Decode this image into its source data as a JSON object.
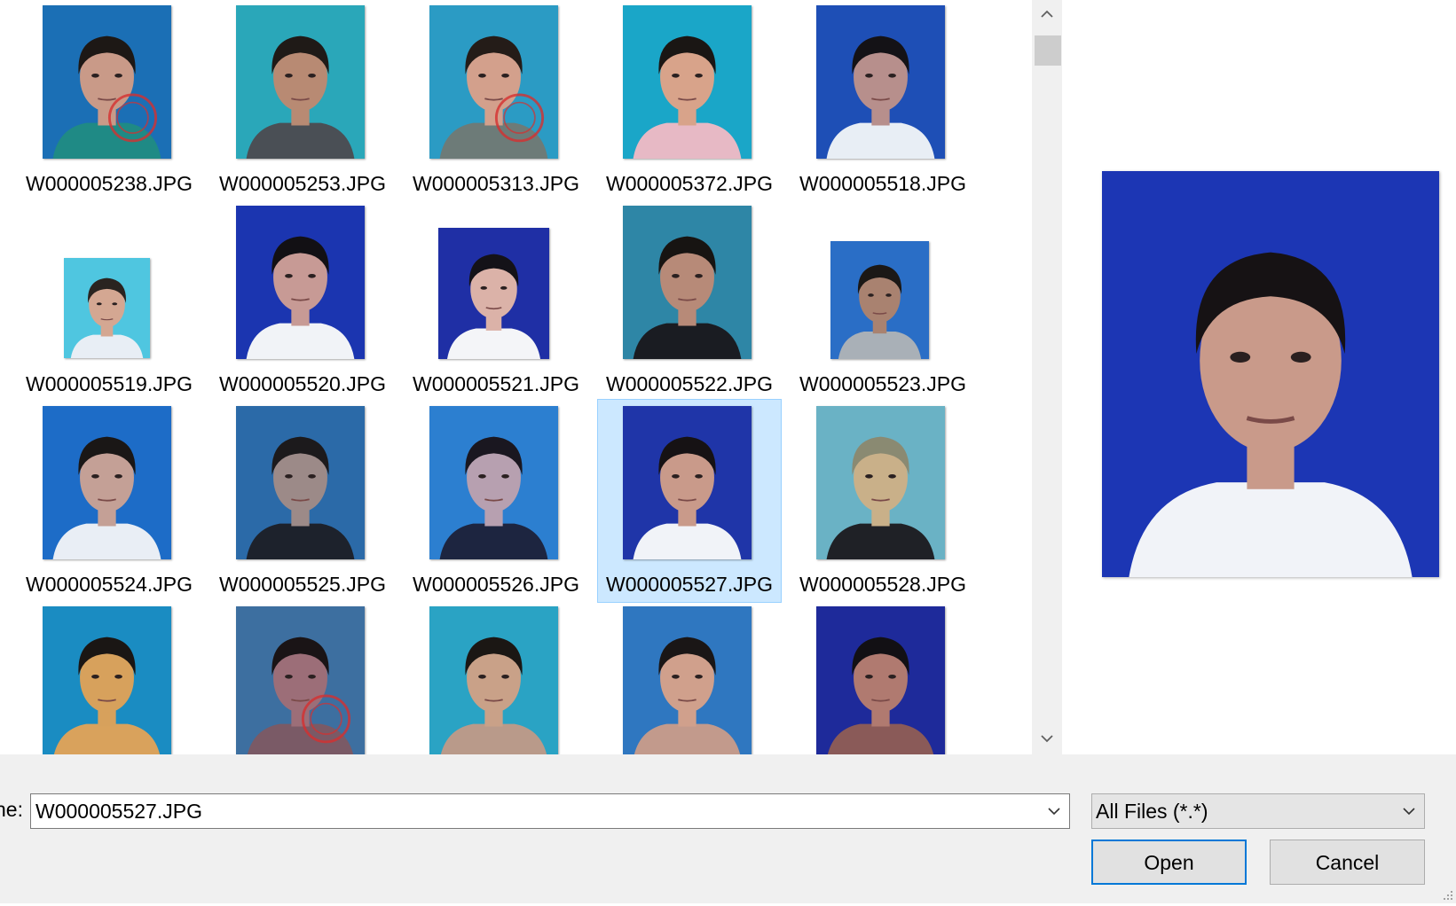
{
  "files": [
    {
      "name": "W000005238.JPG",
      "bg": "#1b6fb5",
      "skin": "#c99a88",
      "hair": "#1d1815",
      "shirt": "#1f8a85",
      "stamp": true
    },
    {
      "name": "W000005253.JPG",
      "bg": "#2aa7b9",
      "skin": "#b88a73",
      "hair": "#1f1a17",
      "shirt": "#4a4f55",
      "stamp": false
    },
    {
      "name": "W000005313.JPG",
      "bg": "#2b9bc4",
      "skin": "#d3a08c",
      "hair": "#241c18",
      "shirt": "#6d7b78",
      "stamp": true
    },
    {
      "name": "W000005372.JPG",
      "bg": "#1aa6c8",
      "skin": "#d8a38a",
      "hair": "#1a1614",
      "shirt": "#e7b9c5",
      "stamp": false
    },
    {
      "name": "W000005518.JPG",
      "bg": "#1e4fb6",
      "skin": "#b78f8c",
      "hair": "#141216",
      "shirt": "#e8eef5",
      "stamp": false
    },
    {
      "name": "W000005519.JPG",
      "bg": "#4fc6e0",
      "skin": "#d4a792",
      "hair": "#2a2420",
      "shirt": "#e8eef5",
      "stamp": false
    },
    {
      "name": "W000005520.JPG",
      "bg": "#1b35b0",
      "skin": "#c79a95",
      "hair": "#121014",
      "shirt": "#f1f3f7",
      "stamp": false
    },
    {
      "name": "W000005521.JPG",
      "bg": "#1f2fa5",
      "skin": "#dbb2a8",
      "hair": "#141218",
      "shirt": "#f4f5f8",
      "stamp": false
    },
    {
      "name": "W000005522.JPG",
      "bg": "#2e86a6",
      "skin": "#b78a78",
      "hair": "#171412",
      "shirt": "#1a1c22",
      "stamp": false
    },
    {
      "name": "W000005523.JPG",
      "bg": "#2a6ec6",
      "skin": "#a98270",
      "hair": "#1b1816",
      "shirt": "#a9b0b7",
      "stamp": false
    },
    {
      "name": "W000005524.JPG",
      "bg": "#1d6cc7",
      "skin": "#c4a096",
      "hair": "#1a1716",
      "shirt": "#e9eef5",
      "stamp": false
    },
    {
      "name": "W000005525.JPG",
      "bg": "#2b6aa8",
      "skin": "#9c8a88",
      "hair": "#1c1a1c",
      "shirt": "#1d222c",
      "stamp": false
    },
    {
      "name": "W000005526.JPG",
      "bg": "#2c7fd0",
      "skin": "#b7a0b0",
      "hair": "#1a1720",
      "shirt": "#1d2540",
      "stamp": false
    },
    {
      "name": "W000005527.JPG",
      "bg": "#1f35a8",
      "skin": "#c99a8a",
      "hair": "#161214",
      "shirt": "#f1f3f8",
      "stamp": false
    },
    {
      "name": "W000005528.JPG",
      "bg": "#6ab2c5",
      "skin": "#c9b089",
      "hair": "#8a8a72",
      "shirt": "#1f2126",
      "stamp": false
    },
    {
      "name": "",
      "bg": "#1a8cc2",
      "skin": "#d7a15c",
      "hair": "#1a1614",
      "shirt": "#d9a25c",
      "stamp": false
    },
    {
      "name": "",
      "bg": "#3d6fa0",
      "skin": "#9c6e78",
      "hair": "#1a1416",
      "shirt": "#7a5a66",
      "stamp": true
    },
    {
      "name": "",
      "bg": "#2aa3c4",
      "skin": "#c9a188",
      "hair": "#1b1714",
      "shirt": "#b99a8a",
      "stamp": false
    },
    {
      "name": "",
      "bg": "#2f77c0",
      "skin": "#d0a08c",
      "hair": "#1a1616",
      "shirt": "#c29a8c",
      "stamp": false
    },
    {
      "name": "",
      "bg": "#1e2a9a",
      "skin": "#b07a70",
      "hair": "#121014",
      "shirt": "#8a5a58",
      "stamp": false
    }
  ],
  "selected_index": 13,
  "preview": {
    "bg": "#1c36b4",
    "skin": "#c99a8a",
    "hair": "#161214",
    "shirt": "#f1f3f8"
  },
  "scrollbar": {
    "up_icon": "chevron-up-icon",
    "down_icon": "chevron-down-icon",
    "scroll_position": 0.05
  },
  "filename_label": "ne:",
  "filename_value": "W000005527.JPG",
  "filetype_value": "All Files (*.*)",
  "open_label": "Open",
  "cancel_label": "Cancel"
}
